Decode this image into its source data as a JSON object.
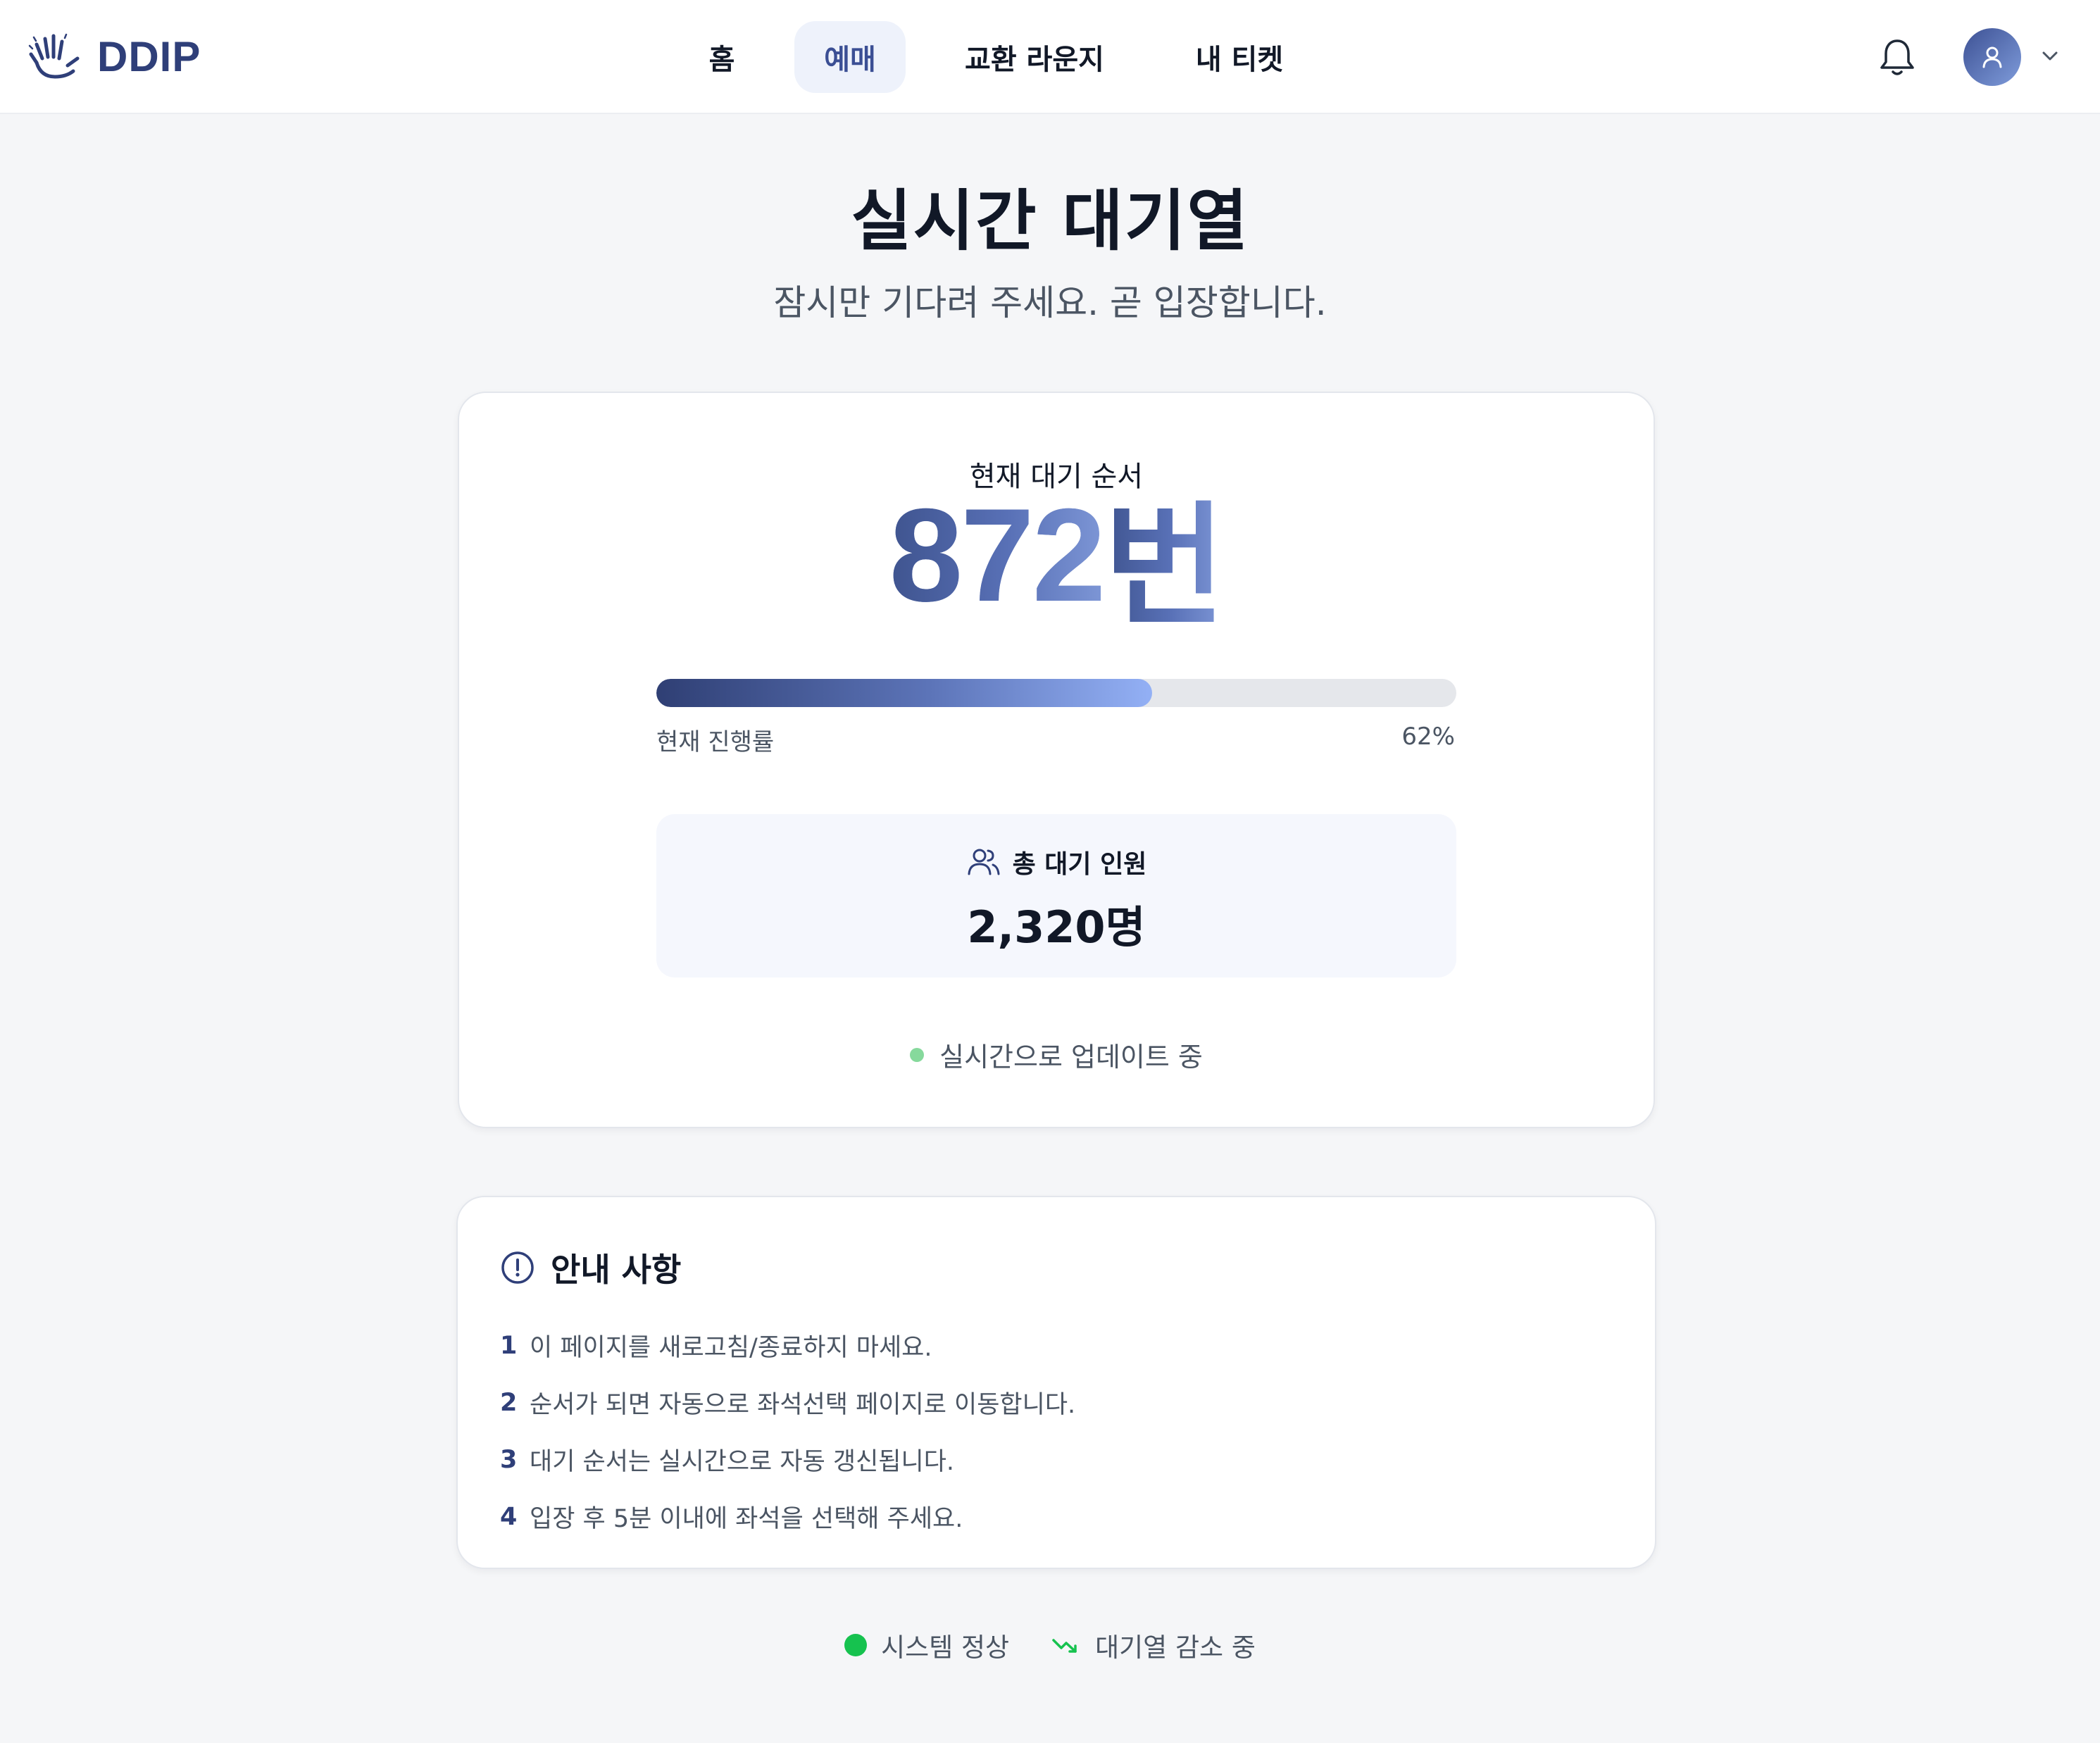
{
  "brand": {
    "name": "DDIP"
  },
  "nav": {
    "items": [
      {
        "label": "홈",
        "active": false
      },
      {
        "label": "예매",
        "active": true
      },
      {
        "label": "교환 라운지",
        "active": false
      },
      {
        "label": "내 티켓",
        "active": false
      }
    ]
  },
  "header_icons": {
    "notifications": "bell-icon",
    "profile": "user-icon",
    "menu": "chevron-down-icon"
  },
  "page": {
    "title": "실시간 대기열",
    "subtitle": "잠시만 기다려 주세요. 곧 입장합니다."
  },
  "queue": {
    "label": "현재 대기 순서",
    "position": "872",
    "position_unit": "번",
    "progress_label": "현재 진행률",
    "progress_text": "62%",
    "progress_percent": 62,
    "total_label": "총 대기 인원",
    "total_value": "2,320명",
    "live_text": "실시간으로 업데이트 중"
  },
  "notice": {
    "title": "안내 사항",
    "items": [
      {
        "num": "1",
        "text": "이 페이지를 새로고침/종료하지 마세요."
      },
      {
        "num": "2",
        "text": "순서가 되면 자동으로 좌석선택 페이지로 이동합니다."
      },
      {
        "num": "3",
        "text": "대기 순서는 실시간으로 자동 갱신됩니다."
      },
      {
        "num": "4",
        "text": "입장 후 5분 이내에 좌석을 선택해 주세요."
      }
    ]
  },
  "status": {
    "system": "시스템 정상",
    "trend": "대기열 감소 중"
  },
  "colors": {
    "brand": "#2f3f79",
    "active_nav_bg": "#eef2fb",
    "progress_start": "#2f3f74",
    "progress_end": "#93b0f5",
    "live_dot": "#86d99c",
    "status_ok": "#16c24f"
  }
}
